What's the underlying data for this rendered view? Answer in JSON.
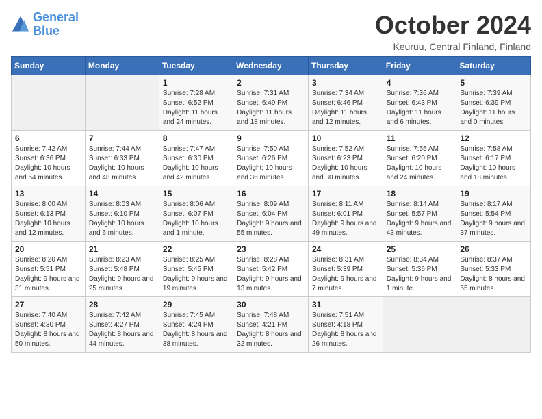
{
  "logo": {
    "line1": "General",
    "line2": "Blue"
  },
  "title": "October 2024",
  "location": "Keuruu, Central Finland, Finland",
  "weekdays": [
    "Sunday",
    "Monday",
    "Tuesday",
    "Wednesday",
    "Thursday",
    "Friday",
    "Saturday"
  ],
  "weeks": [
    [
      {
        "day": "",
        "sunrise": "",
        "sunset": "",
        "daylight": ""
      },
      {
        "day": "",
        "sunrise": "",
        "sunset": "",
        "daylight": ""
      },
      {
        "day": "1",
        "sunrise": "Sunrise: 7:28 AM",
        "sunset": "Sunset: 6:52 PM",
        "daylight": "Daylight: 11 hours and 24 minutes."
      },
      {
        "day": "2",
        "sunrise": "Sunrise: 7:31 AM",
        "sunset": "Sunset: 6:49 PM",
        "daylight": "Daylight: 11 hours and 18 minutes."
      },
      {
        "day": "3",
        "sunrise": "Sunrise: 7:34 AM",
        "sunset": "Sunset: 6:46 PM",
        "daylight": "Daylight: 11 hours and 12 minutes."
      },
      {
        "day": "4",
        "sunrise": "Sunrise: 7:36 AM",
        "sunset": "Sunset: 6:43 PM",
        "daylight": "Daylight: 11 hours and 6 minutes."
      },
      {
        "day": "5",
        "sunrise": "Sunrise: 7:39 AM",
        "sunset": "Sunset: 6:39 PM",
        "daylight": "Daylight: 11 hours and 0 minutes."
      }
    ],
    [
      {
        "day": "6",
        "sunrise": "Sunrise: 7:42 AM",
        "sunset": "Sunset: 6:36 PM",
        "daylight": "Daylight: 10 hours and 54 minutes."
      },
      {
        "day": "7",
        "sunrise": "Sunrise: 7:44 AM",
        "sunset": "Sunset: 6:33 PM",
        "daylight": "Daylight: 10 hours and 48 minutes."
      },
      {
        "day": "8",
        "sunrise": "Sunrise: 7:47 AM",
        "sunset": "Sunset: 6:30 PM",
        "daylight": "Daylight: 10 hours and 42 minutes."
      },
      {
        "day": "9",
        "sunrise": "Sunrise: 7:50 AM",
        "sunset": "Sunset: 6:26 PM",
        "daylight": "Daylight: 10 hours and 36 minutes."
      },
      {
        "day": "10",
        "sunrise": "Sunrise: 7:52 AM",
        "sunset": "Sunset: 6:23 PM",
        "daylight": "Daylight: 10 hours and 30 minutes."
      },
      {
        "day": "11",
        "sunrise": "Sunrise: 7:55 AM",
        "sunset": "Sunset: 6:20 PM",
        "daylight": "Daylight: 10 hours and 24 minutes."
      },
      {
        "day": "12",
        "sunrise": "Sunrise: 7:58 AM",
        "sunset": "Sunset: 6:17 PM",
        "daylight": "Daylight: 10 hours and 18 minutes."
      }
    ],
    [
      {
        "day": "13",
        "sunrise": "Sunrise: 8:00 AM",
        "sunset": "Sunset: 6:13 PM",
        "daylight": "Daylight: 10 hours and 12 minutes."
      },
      {
        "day": "14",
        "sunrise": "Sunrise: 8:03 AM",
        "sunset": "Sunset: 6:10 PM",
        "daylight": "Daylight: 10 hours and 6 minutes."
      },
      {
        "day": "15",
        "sunrise": "Sunrise: 8:06 AM",
        "sunset": "Sunset: 6:07 PM",
        "daylight": "Daylight: 10 hours and 1 minute."
      },
      {
        "day": "16",
        "sunrise": "Sunrise: 8:09 AM",
        "sunset": "Sunset: 6:04 PM",
        "daylight": "Daylight: 9 hours and 55 minutes."
      },
      {
        "day": "17",
        "sunrise": "Sunrise: 8:11 AM",
        "sunset": "Sunset: 6:01 PM",
        "daylight": "Daylight: 9 hours and 49 minutes."
      },
      {
        "day": "18",
        "sunrise": "Sunrise: 8:14 AM",
        "sunset": "Sunset: 5:57 PM",
        "daylight": "Daylight: 9 hours and 43 minutes."
      },
      {
        "day": "19",
        "sunrise": "Sunrise: 8:17 AM",
        "sunset": "Sunset: 5:54 PM",
        "daylight": "Daylight: 9 hours and 37 minutes."
      }
    ],
    [
      {
        "day": "20",
        "sunrise": "Sunrise: 8:20 AM",
        "sunset": "Sunset: 5:51 PM",
        "daylight": "Daylight: 9 hours and 31 minutes."
      },
      {
        "day": "21",
        "sunrise": "Sunrise: 8:23 AM",
        "sunset": "Sunset: 5:48 PM",
        "daylight": "Daylight: 9 hours and 25 minutes."
      },
      {
        "day": "22",
        "sunrise": "Sunrise: 8:25 AM",
        "sunset": "Sunset: 5:45 PM",
        "daylight": "Daylight: 9 hours and 19 minutes."
      },
      {
        "day": "23",
        "sunrise": "Sunrise: 8:28 AM",
        "sunset": "Sunset: 5:42 PM",
        "daylight": "Daylight: 9 hours and 13 minutes."
      },
      {
        "day": "24",
        "sunrise": "Sunrise: 8:31 AM",
        "sunset": "Sunset: 5:39 PM",
        "daylight": "Daylight: 9 hours and 7 minutes."
      },
      {
        "day": "25",
        "sunrise": "Sunrise: 8:34 AM",
        "sunset": "Sunset: 5:36 PM",
        "daylight": "Daylight: 9 hours and 1 minute."
      },
      {
        "day": "26",
        "sunrise": "Sunrise: 8:37 AM",
        "sunset": "Sunset: 5:33 PM",
        "daylight": "Daylight: 8 hours and 55 minutes."
      }
    ],
    [
      {
        "day": "27",
        "sunrise": "Sunrise: 7:40 AM",
        "sunset": "Sunset: 4:30 PM",
        "daylight": "Daylight: 8 hours and 50 minutes."
      },
      {
        "day": "28",
        "sunrise": "Sunrise: 7:42 AM",
        "sunset": "Sunset: 4:27 PM",
        "daylight": "Daylight: 8 hours and 44 minutes."
      },
      {
        "day": "29",
        "sunrise": "Sunrise: 7:45 AM",
        "sunset": "Sunset: 4:24 PM",
        "daylight": "Daylight: 8 hours and 38 minutes."
      },
      {
        "day": "30",
        "sunrise": "Sunrise: 7:48 AM",
        "sunset": "Sunset: 4:21 PM",
        "daylight": "Daylight: 8 hours and 32 minutes."
      },
      {
        "day": "31",
        "sunrise": "Sunrise: 7:51 AM",
        "sunset": "Sunset: 4:18 PM",
        "daylight": "Daylight: 8 hours and 26 minutes."
      },
      {
        "day": "",
        "sunrise": "",
        "sunset": "",
        "daylight": ""
      },
      {
        "day": "",
        "sunrise": "",
        "sunset": "",
        "daylight": ""
      }
    ]
  ]
}
